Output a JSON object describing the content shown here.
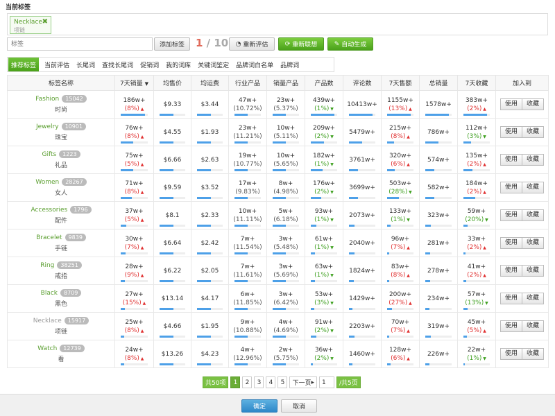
{
  "header": {
    "title": "当前标签"
  },
  "current_tag": {
    "en": "Necklace",
    "cn": "项链",
    "remove": "✖"
  },
  "toolbar": {
    "input_placeholder": "标签",
    "add_label": "添加标签",
    "count_current": "1",
    "count_sep": " / ",
    "count_max": "10",
    "reevaluate_label": "重新评估",
    "reassociate_label": "重新联想",
    "autogen_label": "自动生成"
  },
  "tabs": [
    "推荐标签",
    "当前评估",
    "长尾词",
    "查找长尾词",
    "促销词",
    "我的词库",
    "关键词鉴定",
    "品牌词白名单",
    "品牌词"
  ],
  "columns": [
    "标签名称",
    "7天销量",
    "均售价",
    "均运费",
    "行业产品",
    "销量产品",
    "产品数",
    "评论数",
    "7天售额",
    "总销量",
    "7天收藏",
    "加入到"
  ],
  "sort_icon": "▼",
  "actions": {
    "use": "使用",
    "fav": "收藏"
  },
  "rows": [
    {
      "en": "Fashion",
      "badge": "15042",
      "cn": "时尚",
      "sales": "186w+",
      "sales_pct": "(8%)",
      "sales_dir": "up",
      "sales_bar": 0.9,
      "price": "$9.33",
      "ship": "$3.44",
      "ind": "47w+",
      "ind_pct": "(10.72%)",
      "sold": "23w+",
      "sold_pct": "(5.37%)",
      "prod": "439w+",
      "prod_pct": "(1%)",
      "prod_dir": "dn",
      "prod_bar": 0.9,
      "reviews": "10413w+",
      "rev_bar": 0.9,
      "amt": "1155w+",
      "amt_pct": "(13%)",
      "amt_dir": "up",
      "amt_bar": 0.9,
      "total": "1578w+",
      "total_bar": 0.9,
      "fav": "383w+",
      "fav_pct": "(2%)",
      "fav_dir": "up",
      "fav_bar": 0.9
    },
    {
      "en": "Jewelry",
      "badge": "10901",
      "cn": "珠宝",
      "sales": "76w+",
      "sales_pct": "(8%)",
      "sales_dir": "up",
      "sales_bar": 0.45,
      "price": "$4.55",
      "ship": "$1.93",
      "ind": "23w+",
      "ind_pct": "(11.21%)",
      "sold": "10w+",
      "sold_pct": "(5.11%)",
      "prod": "209w+",
      "prod_pct": "(2%)",
      "prod_dir": "dn",
      "prod_bar": 0.5,
      "reviews": "5479w+",
      "rev_bar": 0.5,
      "amt": "215w+",
      "amt_pct": "(8%)",
      "amt_dir": "up",
      "amt_bar": 0.25,
      "total": "786w+",
      "total_bar": 0.5,
      "fav": "112w+",
      "fav_pct": "(3%)",
      "fav_dir": "dn",
      "fav_bar": 0.3
    },
    {
      "en": "Gifts",
      "badge": "1223",
      "cn": "礼品",
      "sales": "75w+",
      "sales_pct": "(5%)",
      "sales_dir": "up",
      "sales_bar": 0.45,
      "price": "$6.66",
      "ship": "$2.63",
      "ind": "19w+",
      "ind_pct": "(10.77%)",
      "sold": "10w+",
      "sold_pct": "(5.65%)",
      "prod": "182w+",
      "prod_pct": "(1%)",
      "prod_dir": "dn",
      "prod_bar": 0.45,
      "reviews": "3761w+",
      "rev_bar": 0.35,
      "amt": "320w+",
      "amt_pct": "(6%)",
      "amt_dir": "up",
      "amt_bar": 0.3,
      "total": "574w+",
      "total_bar": 0.35,
      "fav": "135w+",
      "fav_pct": "(2%)",
      "fav_dir": "up",
      "fav_bar": 0.35
    },
    {
      "en": "Women",
      "badge": "28267",
      "cn": "女人",
      "sales": "71w+",
      "sales_pct": "(8%)",
      "sales_dir": "up",
      "sales_bar": 0.4,
      "price": "$9.59",
      "ship": "$3.52",
      "ind": "17w+",
      "ind_pct": "(9.83%)",
      "sold": "8w+",
      "sold_pct": "(4.98%)",
      "prod": "176w+",
      "prod_pct": "(2%)",
      "prod_dir": "dn",
      "prod_bar": 0.4,
      "reviews": "3699w+",
      "rev_bar": 0.35,
      "amt": "503w+",
      "amt_pct": "(28%)",
      "amt_dir": "dn",
      "amt_bar": 0.45,
      "total": "582w+",
      "total_bar": 0.35,
      "fav": "184w+",
      "fav_pct": "(2%)",
      "fav_dir": "up",
      "fav_bar": 0.45
    },
    {
      "en": "Accessories",
      "badge": "1796",
      "cn": "配件",
      "sales": "37w+",
      "sales_pct": "(5%)",
      "sales_dir": "up",
      "sales_bar": 0.2,
      "price": "$8.1",
      "ship": "$2.33",
      "ind": "10w+",
      "ind_pct": "(11.11%)",
      "sold": "5w+",
      "sold_pct": "(6.18%)",
      "prod": "93w+",
      "prod_pct": "(1%)",
      "prod_dir": "dn",
      "prod_bar": 0.22,
      "reviews": "2073w+",
      "rev_bar": 0.2,
      "amt": "133w+",
      "amt_pct": "(1%)",
      "amt_dir": "dn",
      "amt_bar": 0.12,
      "total": "323w+",
      "total_bar": 0.2,
      "fav": "59w+",
      "fav_pct": "(20%)",
      "fav_dir": "dn",
      "fav_bar": 0.15
    },
    {
      "en": "Bracelet",
      "badge": "9839",
      "cn": "手链",
      "sales": "30w+",
      "sales_pct": "(7%)",
      "sales_dir": "up",
      "sales_bar": 0.17,
      "price": "$6.64",
      "ship": "$2.42",
      "ind": "7w+",
      "ind_pct": "(11.54%)",
      "sold": "3w+",
      "sold_pct": "(5.48%)",
      "prod": "61w+",
      "prod_pct": "(1%)",
      "prod_dir": "dn",
      "prod_bar": 0.15,
      "reviews": "2040w+",
      "rev_bar": 0.2,
      "amt": "96w+",
      "amt_pct": "(7%)",
      "amt_dir": "up",
      "amt_bar": 0.09,
      "total": "281w+",
      "total_bar": 0.18,
      "fav": "33w+",
      "fav_pct": "(2%)",
      "fav_dir": "up",
      "fav_bar": 0.09
    },
    {
      "en": "Ring",
      "badge": "38251",
      "cn": "戒指",
      "sales": "28w+",
      "sales_pct": "(9%)",
      "sales_dir": "up",
      "sales_bar": 0.16,
      "price": "$6.22",
      "ship": "$2.05",
      "ind": "7w+",
      "ind_pct": "(11.61%)",
      "sold": "3w+",
      "sold_pct": "(5.69%)",
      "prod": "63w+",
      "prod_pct": "(1%)",
      "prod_dir": "dn",
      "prod_bar": 0.15,
      "reviews": "1824w+",
      "rev_bar": 0.18,
      "amt": "83w+",
      "amt_pct": "(8%)",
      "amt_dir": "up",
      "amt_bar": 0.08,
      "total": "278w+",
      "total_bar": 0.18,
      "fav": "41w+",
      "fav_pct": "(2%)",
      "fav_dir": "up",
      "fav_bar": 0.11
    },
    {
      "en": "Black",
      "badge": "8709",
      "cn": "黑色",
      "sales": "27w+",
      "sales_pct": "(15%)",
      "sales_dir": "up",
      "sales_bar": 0.15,
      "price": "$13.14",
      "ship": "$4.17",
      "ind": "6w+",
      "ind_pct": "(11.85%)",
      "sold": "3w+",
      "sold_pct": "(6.42%)",
      "prod": "53w+",
      "prod_pct": "(3%)",
      "prod_dir": "dn",
      "prod_bar": 0.13,
      "reviews": "1429w+",
      "rev_bar": 0.14,
      "amt": "200w+",
      "amt_pct": "(27%)",
      "amt_dir": "up",
      "amt_bar": 0.18,
      "total": "234w+",
      "total_bar": 0.15,
      "fav": "57w+",
      "fav_pct": "(13%)",
      "fav_dir": "dn",
      "fav_bar": 0.15
    },
    {
      "en": "Necklace",
      "badge": "15917",
      "cn": "项链",
      "muted": true,
      "sales": "25w+",
      "sales_pct": "(8%)",
      "sales_dir": "up",
      "sales_bar": 0.14,
      "price": "$4.66",
      "ship": "$1.95",
      "ind": "9w+",
      "ind_pct": "(10.88%)",
      "sold": "4w+",
      "sold_pct": "(4.69%)",
      "prod": "91w+",
      "prod_pct": "(2%)",
      "prod_dir": "dn",
      "prod_bar": 0.21,
      "reviews": "2203w+",
      "rev_bar": 0.21,
      "amt": "70w+",
      "amt_pct": "(7%)",
      "amt_dir": "up",
      "amt_bar": 0.07,
      "total": "319w+",
      "total_bar": 0.2,
      "fav": "45w+",
      "fav_pct": "(5%)",
      "fav_dir": "up",
      "fav_bar": 0.12
    },
    {
      "en": "Watch",
      "badge": "12739",
      "cn": "看",
      "sales": "24w+",
      "sales_pct": "(8%)",
      "sales_dir": "up",
      "sales_bar": 0.13,
      "price": "$13.26",
      "ship": "$4.23",
      "ind": "4w+",
      "ind_pct": "(12.96%)",
      "sold": "2w+",
      "sold_pct": "(5.75%)",
      "prod": "36w+",
      "prod_pct": "(2%)",
      "prod_dir": "dn",
      "prod_bar": 0.09,
      "reviews": "1460w+",
      "rev_bar": 0.14,
      "amt": "128w+",
      "amt_pct": "(6%)",
      "amt_dir": "up",
      "amt_bar": 0.12,
      "total": "226w+",
      "total_bar": 0.15,
      "fav": "22w+",
      "fav_pct": "(1%)",
      "fav_dir": "dn",
      "fav_bar": 0.06
    }
  ],
  "pager": {
    "total": "共50项",
    "pages": [
      "1",
      "2",
      "3",
      "4",
      "5"
    ],
    "current": "1",
    "next": "下一页",
    "input_value": "1",
    "page_total": "/共5页"
  },
  "footer": {
    "ok": "确定",
    "cancel": "取消"
  },
  "colors": {
    "green": "#5a9e2f",
    "blue_bar": "#4da0e8",
    "up": "#e03030",
    "down": "#3fa020"
  }
}
